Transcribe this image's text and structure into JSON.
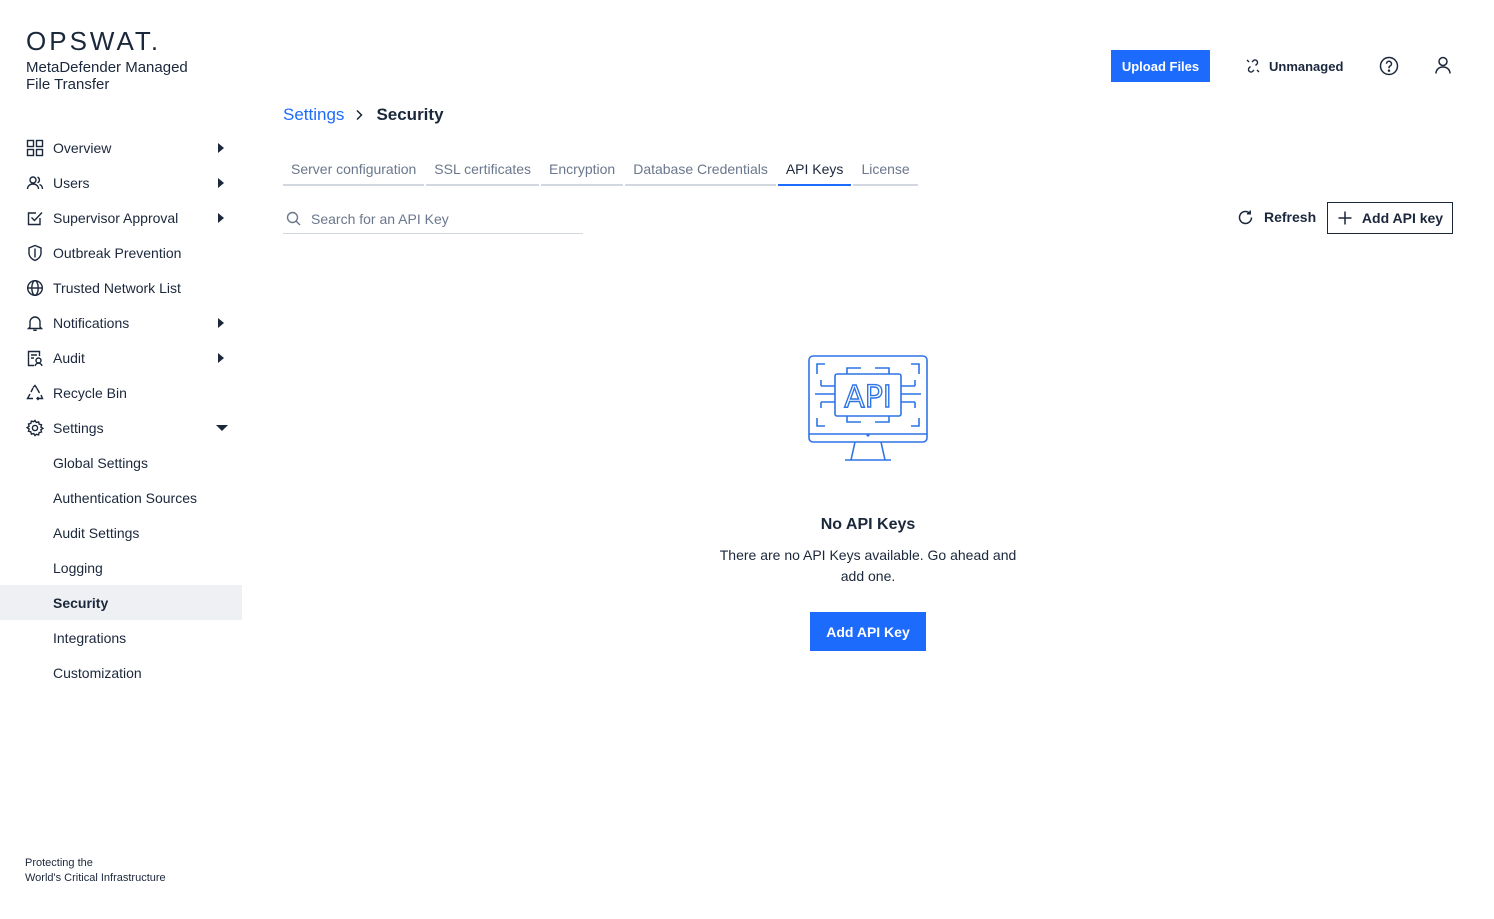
{
  "brand": {
    "logo": "OPSWAT.",
    "product": "MetaDefender Managed File Transfer",
    "tagline_line1": "Protecting the",
    "tagline_line2": "World's Critical Infrastructure"
  },
  "header": {
    "upload_label": "Upload Files",
    "unmanaged_label": "Unmanaged",
    "accent_color": "#1d6bfc"
  },
  "sidebar": {
    "items": [
      {
        "label": "Overview",
        "icon": "grid-icon",
        "expandable": true
      },
      {
        "label": "Users",
        "icon": "users-icon",
        "expandable": true
      },
      {
        "label": "Supervisor Approval",
        "icon": "approval-icon",
        "expandable": true
      },
      {
        "label": "Outbreak Prevention",
        "icon": "shield-icon",
        "expandable": false
      },
      {
        "label": "Trusted Network List",
        "icon": "globe-icon",
        "expandable": false
      },
      {
        "label": "Notifications",
        "icon": "bell-icon",
        "expandable": true
      },
      {
        "label": "Audit",
        "icon": "audit-icon",
        "expandable": true
      },
      {
        "label": "Recycle Bin",
        "icon": "recycle-icon",
        "expandable": false
      },
      {
        "label": "Settings",
        "icon": "gear-icon",
        "expandable": true,
        "expanded": true
      }
    ],
    "settings_sub": [
      {
        "label": "Global Settings"
      },
      {
        "label": "Authentication Sources"
      },
      {
        "label": "Audit Settings"
      },
      {
        "label": "Logging"
      },
      {
        "label": "Security",
        "active": true
      },
      {
        "label": "Integrations"
      },
      {
        "label": "Customization"
      }
    ]
  },
  "breadcrumb": {
    "parent": "Settings",
    "current": "Security"
  },
  "tabs": [
    {
      "label": "Server configuration"
    },
    {
      "label": "SSL certificates"
    },
    {
      "label": "Encryption"
    },
    {
      "label": "Database Credentials"
    },
    {
      "label": "API Keys",
      "active": true
    },
    {
      "label": "License"
    }
  ],
  "toolbar": {
    "search_placeholder": "Search for an API Key",
    "refresh_label": "Refresh",
    "add_label": "Add API key"
  },
  "empty_state": {
    "illustration_text": "API",
    "title": "No API Keys",
    "description": "There are no API Keys available. Go ahead and add one.",
    "button_label": "Add API Key"
  }
}
